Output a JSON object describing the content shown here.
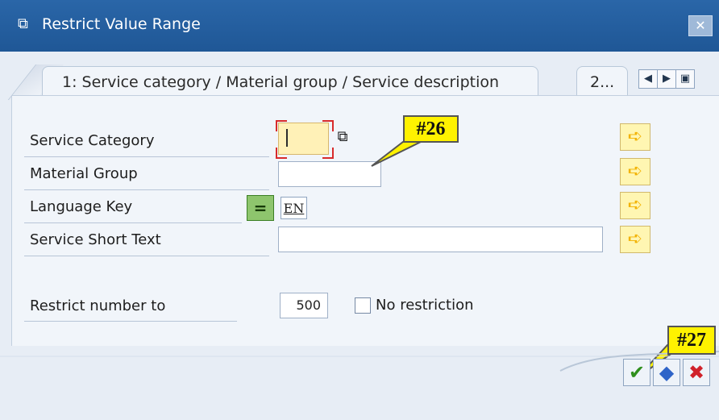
{
  "window": {
    "title": "Restrict Value Range",
    "close_label": "✕"
  },
  "tabs": [
    {
      "label": "1: Service category / Material group / Service description"
    },
    {
      "label": "2..."
    }
  ],
  "fields": {
    "service_category": {
      "label": "Service Category",
      "value": ""
    },
    "material_group": {
      "label": "Material Group",
      "value": ""
    },
    "language_key": {
      "label": "Language Key",
      "operator": "=",
      "value": "EN"
    },
    "service_short_text": {
      "label": "Service Short Text",
      "value": ""
    },
    "restrict_number": {
      "label": "Restrict number to",
      "value": "500"
    },
    "no_restriction": {
      "label": "No restriction",
      "checked": false
    }
  },
  "callouts": {
    "first": "#26",
    "second": "#27"
  },
  "footer": {
    "confirm": "✔",
    "multi_select": "◆",
    "cancel": "✖"
  }
}
